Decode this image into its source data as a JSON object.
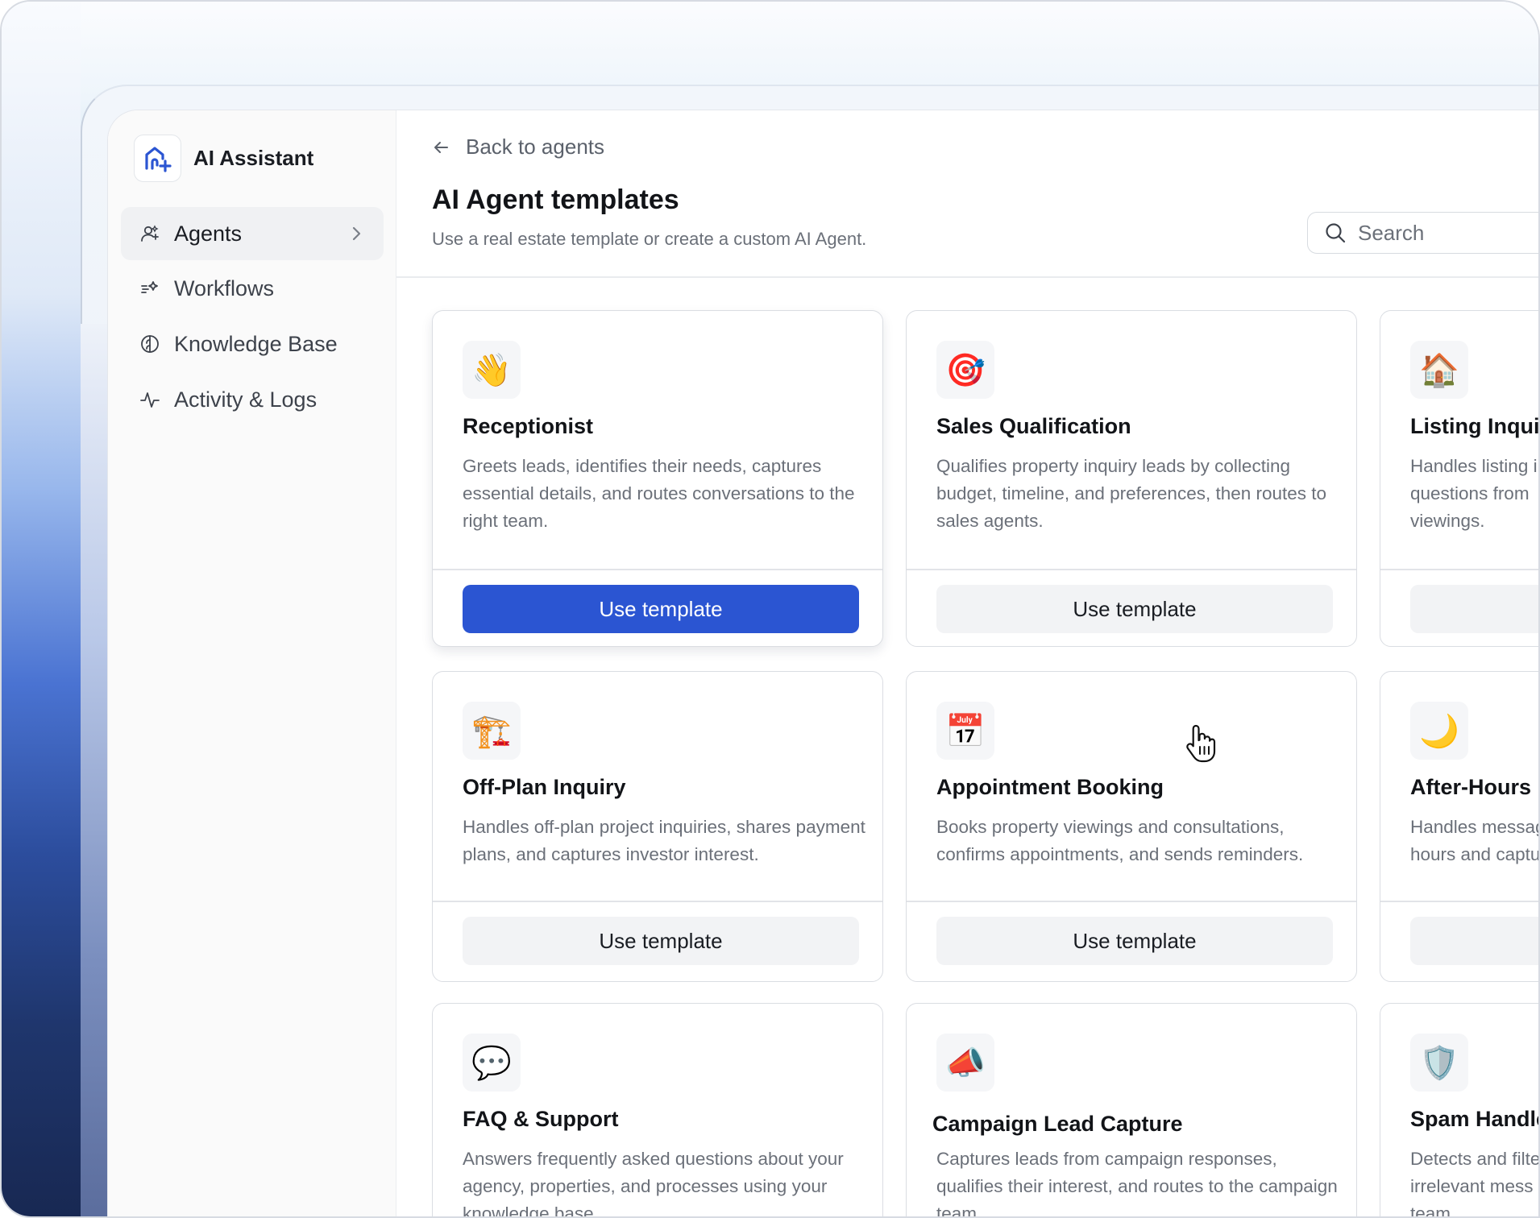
{
  "sidebar": {
    "app_name": "AI Assistant",
    "items": [
      {
        "label": "Agents",
        "icon": "agents-icon",
        "active": true
      },
      {
        "label": "Workflows",
        "icon": "workflows-icon",
        "active": false
      },
      {
        "label": "Knowledge Base",
        "icon": "brain-icon",
        "active": false
      },
      {
        "label": "Activity & Logs",
        "icon": "activity-icon",
        "active": false
      }
    ]
  },
  "header": {
    "back_label": "Back to agents",
    "title": "AI Agent templates",
    "subtitle": "Use a real estate template or create a custom AI Agent.",
    "search_placeholder": "Search"
  },
  "templates": [
    {
      "emoji": "👋",
      "name": "Receptionist",
      "description": "Greets leads, identifies their needs, captures essential details, and routes conversations to the right team.",
      "button": "Use template",
      "highlighted": true
    },
    {
      "emoji": "🎯",
      "name": "Sales Qualification",
      "description": "Qualifies property inquiry leads by collecting budget, timeline, and preferences, then routes to sales agents.",
      "button": "Use template",
      "highlighted": false
    },
    {
      "emoji": "🏠",
      "name": "Listing Inquir",
      "description": "Handles listing i questions from viewings.",
      "button": "",
      "highlighted": false
    },
    {
      "emoji": "🏗️",
      "name": "Off-Plan Inquiry",
      "description": "Handles off-plan project inquiries, shares payment plans, and captures investor interest.",
      "button": "Use template",
      "highlighted": false
    },
    {
      "emoji": "📅",
      "name": "Appointment Booking",
      "description": "Books property viewings and consultations, confirms appointments, and sends reminders.",
      "button": "Use template",
      "highlighted": false
    },
    {
      "emoji": "🌙",
      "name": "After-Hours",
      "description": "Handles messag hours and captu",
      "button": "",
      "highlighted": false
    },
    {
      "emoji": "💬",
      "name": "FAQ & Support",
      "description": "Answers frequently asked questions about your agency, properties, and processes using your knowledge base.",
      "button": "",
      "highlighted": false
    },
    {
      "emoji": "📣",
      "name": "Campaign Lead Capture",
      "description": "Captures leads from campaign responses, qualifies their interest, and routes to the campaign team.",
      "button": "",
      "highlighted": false
    },
    {
      "emoji": "🛡️",
      "name": "Spam Handle",
      "description": "Detects and filte irrelevant mess team.",
      "button": "",
      "highlighted": false
    }
  ],
  "colors": {
    "primary": "#2b55d2",
    "text": "#121418",
    "muted": "#6b7079"
  }
}
